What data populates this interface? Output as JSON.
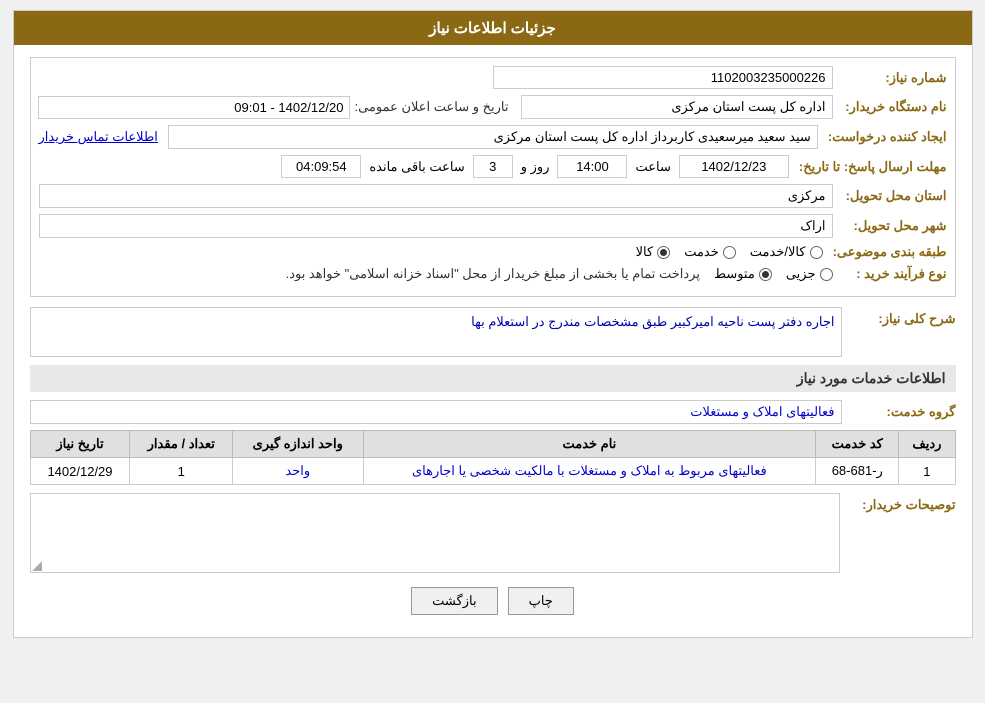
{
  "header": {
    "title": "جزئیات اطلاعات نیاز"
  },
  "fields": {
    "need_number_label": "شماره نیاز:",
    "need_number_value": "1102003235000226",
    "buyer_org_label": "نام دستگاه خریدار:",
    "buyer_org_value": "اداره کل پست استان مرکزی",
    "announcement_date_label": "تاریخ و ساعت اعلان عمومی:",
    "announcement_date_value": "1402/12/20 - 09:01",
    "creator_label": "ایجاد کننده درخواست:",
    "creator_value": "سید سعید میرسعیدی کاربرداز اداره کل پست استان مرکزی",
    "creator_link": "اطلاعات تماس خریدار",
    "response_deadline_label": "مهلت ارسال پاسخ: تا تاریخ:",
    "response_date": "1402/12/23",
    "response_time_label": "ساعت",
    "response_time": "14:00",
    "response_day_label": "روز و",
    "response_days": "3",
    "response_remaining_label": "ساعت باقی مانده",
    "response_remaining": "04:09:54",
    "delivery_province_label": "استان محل تحویل:",
    "delivery_province_value": "مرکزی",
    "delivery_city_label": "شهر محل تحویل:",
    "delivery_city_value": "اراک",
    "category_label": "طبقه بندی موضوعی:",
    "category_options": [
      "کالا",
      "خدمت",
      "کالا/خدمت"
    ],
    "category_selected": "کالا",
    "purchase_type_label": "نوع فرآیند خرید :",
    "purchase_options": [
      "جزیی",
      "متوسط"
    ],
    "purchase_note": "پرداخت تمام یا بخشی از مبلغ خریدار از محل \"اسناد خزانه اسلامی\" خواهد بود.",
    "need_description_label": "شرح کلی نیاز:",
    "need_description_value": "اجاره دفتر پست ناحیه امیرکبیر  طبق مشخصات مندرج در استعلام بها",
    "services_section_title": "اطلاعات خدمات مورد نیاز",
    "service_group_label": "گروه خدمت:",
    "service_group_value": "فعالیتهای  املاک و مستغلات",
    "table": {
      "headers": [
        "ردیف",
        "کد خدمت",
        "نام خدمت",
        "واحد اندازه گیری",
        "تعداد / مقدار",
        "تاریخ نیاز"
      ],
      "rows": [
        {
          "row": "1",
          "code": "ر-681-68",
          "name": "فعالیتهای مربوط به املاک و مستغلات با مالکیت شخصی یا اجارهای",
          "unit": "واحد",
          "quantity": "1",
          "date": "1402/12/29"
        }
      ]
    },
    "buyer_comments_label": "توصیحات خریدار:"
  },
  "buttons": {
    "print": "چاپ",
    "back": "بازگشت"
  }
}
